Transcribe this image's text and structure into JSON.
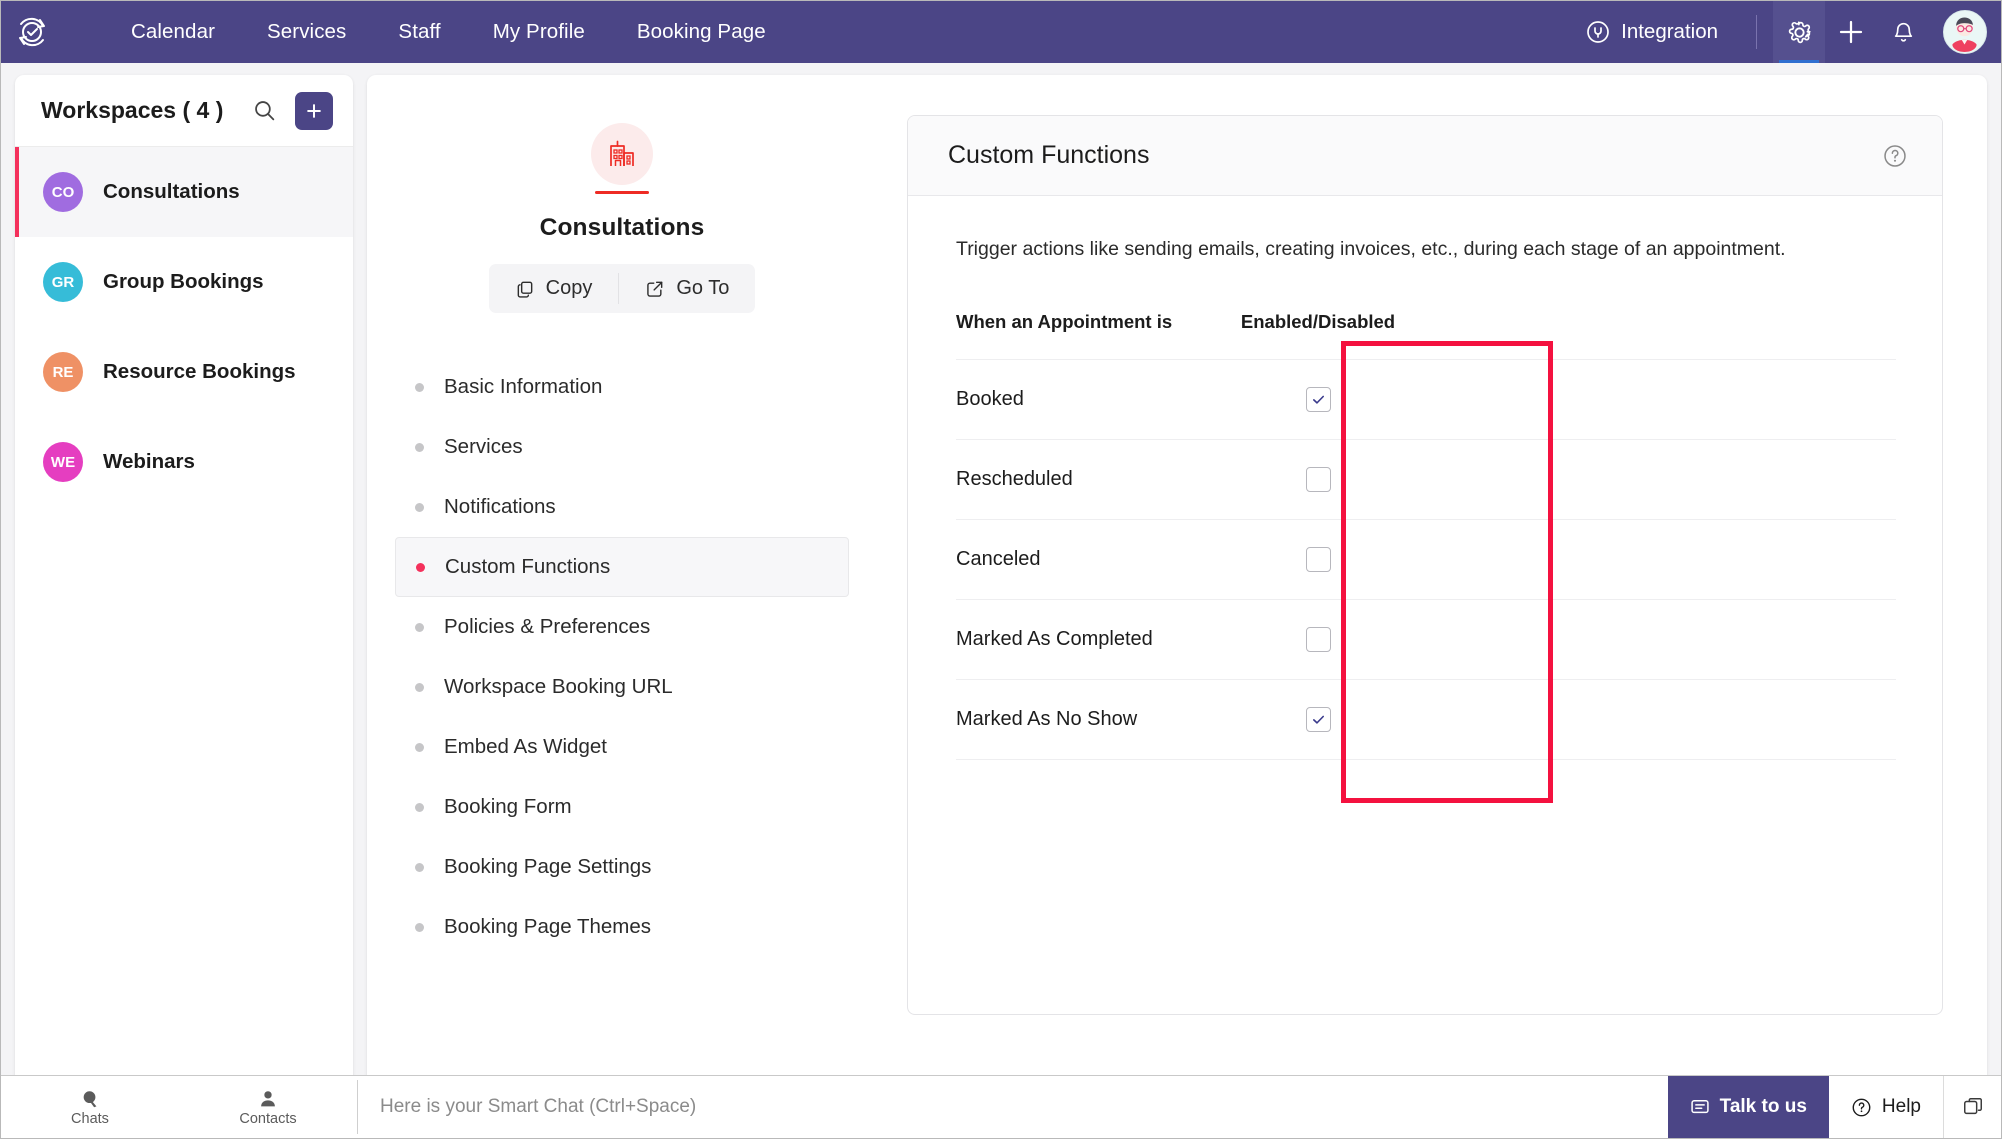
{
  "topnav": {
    "logo_icon": "zoho-bookings-logo-icon",
    "links": [
      {
        "label": "Calendar"
      },
      {
        "label": "Services"
      },
      {
        "label": "Staff"
      },
      {
        "label": "My Profile"
      },
      {
        "label": "Booking Page"
      }
    ],
    "integration_label": "Integration",
    "integration_icon": "plug-icon",
    "settings_icon": "gear-icon",
    "add_icon": "plus-icon",
    "notifications_icon": "bell-icon",
    "avatar": "user-avatar"
  },
  "sidebar": {
    "title": "Workspaces ( 4 )",
    "search_icon": "search-icon",
    "add_icon": "plus-icon",
    "items": [
      {
        "initials": "CO",
        "label": "Consultations",
        "color": "#a06ce0",
        "selected": true
      },
      {
        "initials": "GR",
        "label": "Group Bookings",
        "color": "#36bcd8",
        "selected": false
      },
      {
        "initials": "RE",
        "label": "Resource Bookings",
        "color": "#ef9165",
        "selected": false
      },
      {
        "initials": "WE",
        "label": "Webinars",
        "color": "#e53ec0",
        "selected": false
      }
    ]
  },
  "workspace": {
    "icon": "office-building-icon",
    "name": "Consultations",
    "actions": [
      {
        "label": "Copy",
        "icon": "copy-icon"
      },
      {
        "label": "Go To",
        "icon": "external-link-icon"
      }
    ],
    "nav": [
      {
        "label": "Basic Information",
        "active": false
      },
      {
        "label": "Services",
        "active": false
      },
      {
        "label": "Notifications",
        "active": false
      },
      {
        "label": "Custom Functions",
        "active": true
      },
      {
        "label": "Policies & Preferences",
        "active": false
      },
      {
        "label": "Workspace Booking URL",
        "active": false
      },
      {
        "label": "Embed As Widget",
        "active": false
      },
      {
        "label": "Booking Form",
        "active": false
      },
      {
        "label": "Booking Page Settings",
        "active": false
      },
      {
        "label": "Booking Page Themes",
        "active": false
      }
    ]
  },
  "panel": {
    "title": "Custom Functions",
    "help_icon": "help-circle-icon",
    "description": "Trigger actions like sending emails, creating invoices, etc., during each stage of an appointment.",
    "columns": [
      "When an Appointment is",
      "Enabled/Disabled"
    ],
    "rows": [
      {
        "label": "Booked",
        "enabled": true
      },
      {
        "label": "Rescheduled",
        "enabled": false
      },
      {
        "label": "Canceled",
        "enabled": false
      },
      {
        "label": "Marked As Completed",
        "enabled": false
      },
      {
        "label": "Marked As No Show",
        "enabled": true
      }
    ],
    "annotation_color": "#f4113f"
  },
  "statusbar": {
    "chats_label": "Chats",
    "chats_icon": "chat-bubble-icon",
    "contacts_label": "Contacts",
    "contacts_icon": "person-icon",
    "smart_chat_placeholder": "Here is your Smart Chat (Ctrl+Space)",
    "talk_label": "Talk to us",
    "talk_icon": "chat-icon",
    "help_label": "Help",
    "help_icon": "question-circle-icon",
    "window_icon": "windows-icon"
  },
  "colors": {
    "brand_purple": "#4b4586",
    "accent_pink": "#f4315c",
    "annotation_red": "#f4113f",
    "icon_red": "#ee2b24"
  }
}
